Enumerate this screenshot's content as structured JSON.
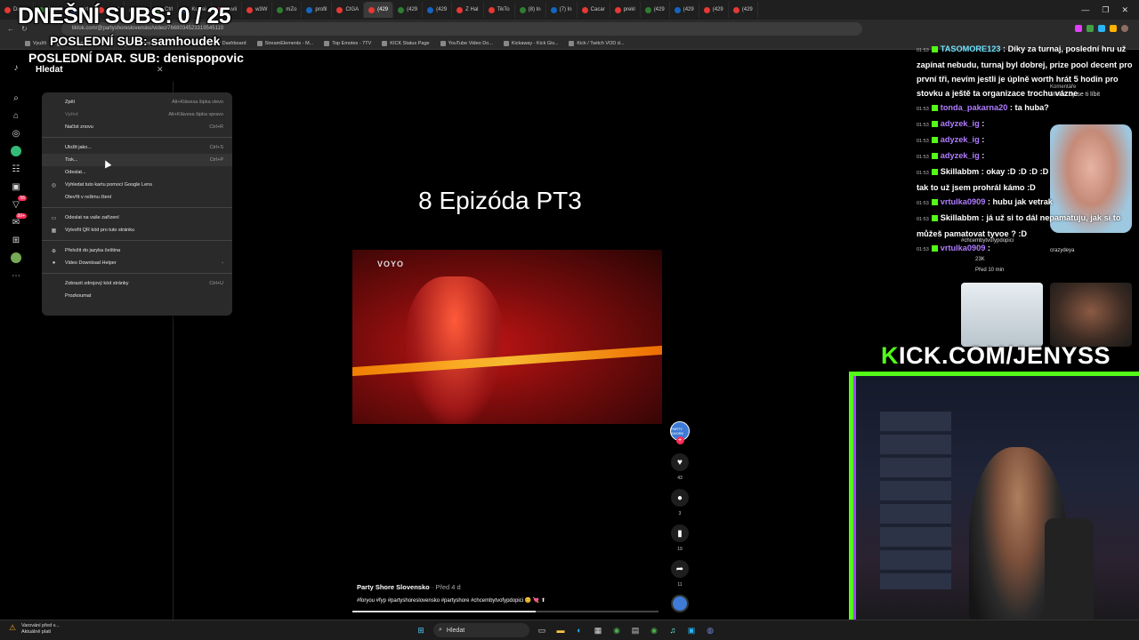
{
  "overlay": {
    "subs_counter": "DNEŠNÍ SUBS: 0 / 25",
    "last_sub": "POSLEDNÍ SUB: samhoudek",
    "last_donation": "POSLEDNÍ DAR. SUB: denispopovic",
    "kick_banner_k": "K",
    "kick_banner_rest": "ICK.COM/JENYSS"
  },
  "browser": {
    "tabs": [
      "Dashb",
      "Zpráv",
      "Ctrl",
      "CtrfV",
      "Ctrl",
      "Ctrl",
      "Kuwei",
      "Havli",
      "w3W",
      "mZo",
      "profil",
      "CIGA",
      "(429",
      "(429",
      "(429",
      "Z Hal",
      "TikTo",
      "(8) In",
      "(7) In",
      "Cacar",
      "prekl",
      "(429",
      "(429",
      "(429",
      "(429"
    ],
    "url": "tiktok.com/@partyshoreslovensko/video/7668034523319545110",
    "bookmarks": [
      "Využít",
      "File Converter - Free...",
      "The best ChatBot an...",
      "Streamer Dashboard",
      "StreamElements - M...",
      "Top Emotes - 7TV",
      "KICK Status Page",
      "YouTube Video Do...",
      "Kickaway - Kick Giv...",
      "Kick / Twitch VOD d..."
    ]
  },
  "tiktok": {
    "search_title": "Hledat",
    "context_menu": [
      {
        "label": "Zpět",
        "shortcut": "Alt+Klávesa šipka vlevo",
        "disabled": false
      },
      {
        "label": "Vpřed",
        "shortcut": "Alt+Klávesa šipka vpravo",
        "disabled": true
      },
      {
        "label": "Načíst znovu",
        "shortcut": "Ctrl+R",
        "disabled": false
      },
      {
        "label": "Uložit jako...",
        "shortcut": "Ctrl+S",
        "disabled": false
      },
      {
        "label": "Tisk...",
        "shortcut": "Ctrl+P",
        "disabled": false
      },
      {
        "label": "Odeslat...",
        "shortcut": "",
        "disabled": false
      },
      {
        "label": "Vyhledat tuto kartu pomocí Google Lens",
        "shortcut": "",
        "disabled": false
      },
      {
        "label": "Otevřít v režimu čtení",
        "shortcut": "",
        "disabled": false
      },
      {
        "label": "Odeslat na vaše zařízení",
        "shortcut": "",
        "disabled": false
      },
      {
        "label": "Vytvořit QR kód pro tuto stránku",
        "shortcut": "",
        "disabled": false
      },
      {
        "label": "Přeložit do jazyka čeština",
        "shortcut": "",
        "disabled": false
      },
      {
        "label": "Video Download Helper",
        "shortcut": "›",
        "disabled": false
      },
      {
        "label": "Zobrazit zdrojový kód stránky",
        "shortcut": "Ctrl+U",
        "disabled": false
      },
      {
        "label": "Prozkoumat",
        "shortcut": "",
        "disabled": false
      }
    ],
    "video_title": "8 Epizóda PT3",
    "watermark": "VOYO",
    "likes": "43",
    "comments": "3",
    "saves": "19",
    "shares": "11",
    "author": "Party Shore Slovensko",
    "posted": "· Před 4 d",
    "caption": "#foryou #fyp #partyshoreslovensko #partyshore #chcembytvofypdopici 😊 💘 ⬆",
    "avatar_text": "PARTY SHORE",
    "sidebar_badges": [
      "56",
      "99+"
    ]
  },
  "chat": [
    {
      "time": "01:53",
      "user": "TASOMORE123",
      "color": "#6fe3ff",
      "text": "Díky za turnaj, poslední hru už zapínat nebudu, turnaj byl dobrej, prize pool decent pro první tři, nevím jestli je úplně worth hrát 5 hodin pro stovku a ještě ta organizace trochu vázne"
    },
    {
      "time": "01:53",
      "user": "tonda_pakarna20",
      "color": "#b07cff",
      "text": "ta huba?"
    },
    {
      "time": "01:53",
      "user": "adyzek_ig",
      "color": "#b07cff",
      "text": ""
    },
    {
      "time": "01:53",
      "user": "adyzek_ig",
      "color": "#b07cff",
      "text": ""
    },
    {
      "time": "01:53",
      "user": "adyzek_ig",
      "color": "#b07cff",
      "text": ""
    },
    {
      "time": "01:53",
      "user": "Skillabbm",
      "color": "#ffffff",
      "text": "okay :D :D :D :D"
    },
    {
      "time": "",
      "user": "",
      "color": "#ffffff",
      "text": "tak to už jsem prohrál kámo :D"
    },
    {
      "time": "01:53",
      "user": "vrtulka0909",
      "color": "#b07cff",
      "text": "hubu jak vetrak"
    },
    {
      "time": "01:53",
      "user": "Skillabbm",
      "color": "#ffffff",
      "text": "já už si to dál nepamatuju, jak si to můžeš pamatovat tyvoe ? :D"
    },
    {
      "time": "01:53",
      "user": "vrtulka0909",
      "color": "#b07cff",
      "text": ""
    }
  ],
  "stream_overlay": {
    "comment_text": "Mohlo by se ti líbit",
    "comments_label": "Komentáře",
    "hashtag": "#chcembytvofypdopici",
    "user": "crazydeya",
    "likes": "23K",
    "time": "Před 10 min"
  },
  "taskbar": {
    "weather_title": "Varování před v...",
    "weather_sub": "Aktuálně platí",
    "search_label": "Hledat"
  }
}
